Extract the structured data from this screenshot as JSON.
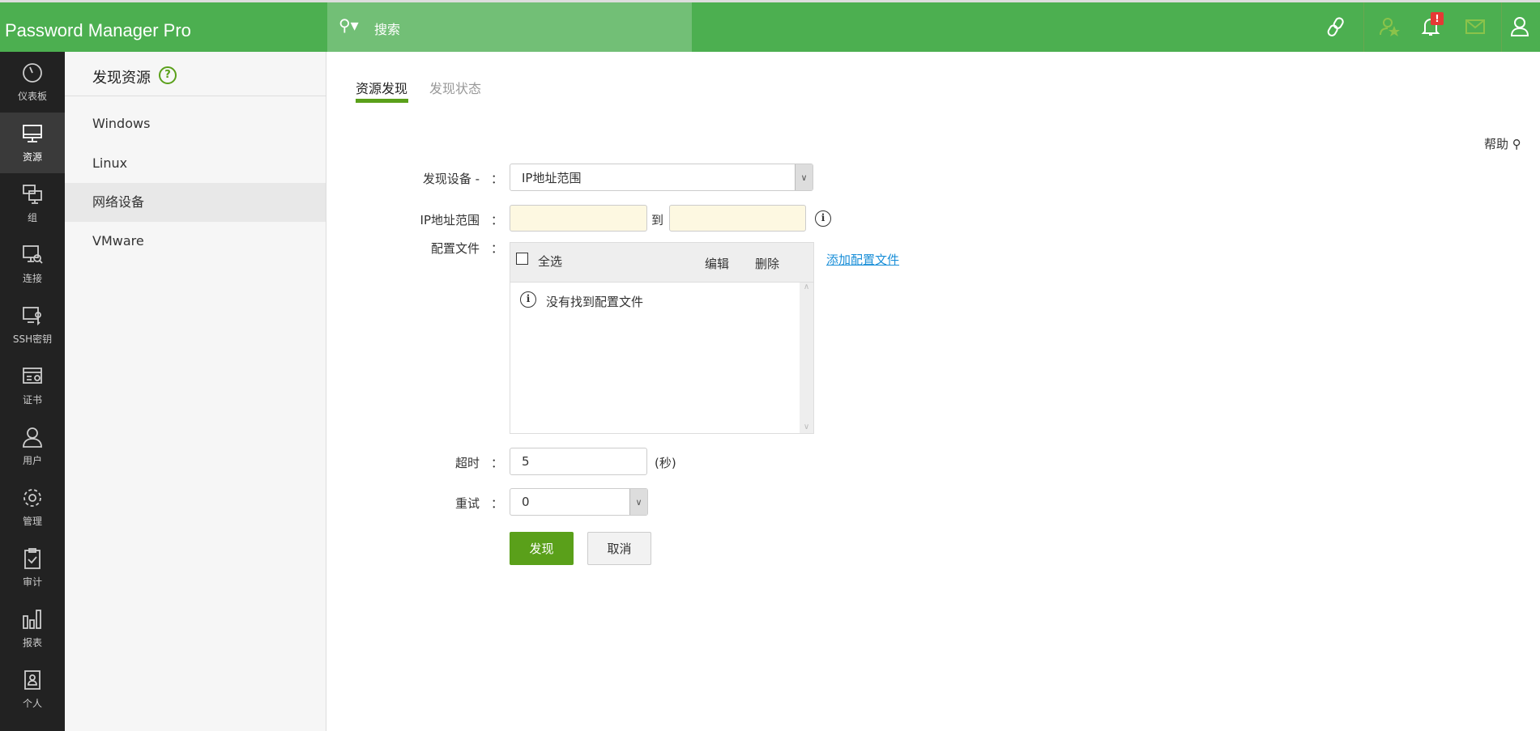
{
  "header": {
    "logo": "Password Manager Pro",
    "search_placeholder": "搜索",
    "notification_badge": "!"
  },
  "nav": {
    "items": [
      {
        "label": "仪表板",
        "icon": "dashboard-icon"
      },
      {
        "label": "资源",
        "icon": "monitor-icon",
        "active": true
      },
      {
        "label": "组",
        "icon": "group-icon"
      },
      {
        "label": "连接",
        "icon": "connection-icon"
      },
      {
        "label": "SSH密钥",
        "icon": "ssh-key-icon"
      },
      {
        "label": "证书",
        "icon": "certificate-icon"
      },
      {
        "label": "用户",
        "icon": "user-icon"
      },
      {
        "label": "管理",
        "icon": "gear-icon"
      },
      {
        "label": "审计",
        "icon": "clipboard-icon"
      },
      {
        "label": "报表",
        "icon": "bar-chart-icon"
      },
      {
        "label": "个人",
        "icon": "personal-icon"
      }
    ]
  },
  "sub": {
    "title": "发现资源",
    "help": "?",
    "items": [
      "Windows",
      "Linux",
      "网络设备",
      "VMware"
    ],
    "selected": "网络设备"
  },
  "tabs": [
    "资源发现",
    "发现状态"
  ],
  "help": "帮助",
  "form": {
    "device_label": "发现设备 -",
    "device_value": "IP地址范围",
    "ip_label": "IP地址范围",
    "ip_from": "",
    "ip_to_label": "到",
    "ip_to": "",
    "profile_label": "配置文件",
    "select_all": "全选",
    "edit": "编辑",
    "delete": "删除",
    "no_profiles": "没有找到配置文件",
    "add_profile": "添加配置文件",
    "timeout_label": "超时",
    "timeout_value": "5",
    "timeout_unit": "(秒)",
    "retry_label": "重试",
    "retry_value": "0",
    "colon": "：",
    "discover_button": "发现",
    "cancel_button": "取消"
  },
  "colors": {
    "brand": "#4caf50",
    "accent": "#5aa01a",
    "link": "#1a8fd8"
  }
}
